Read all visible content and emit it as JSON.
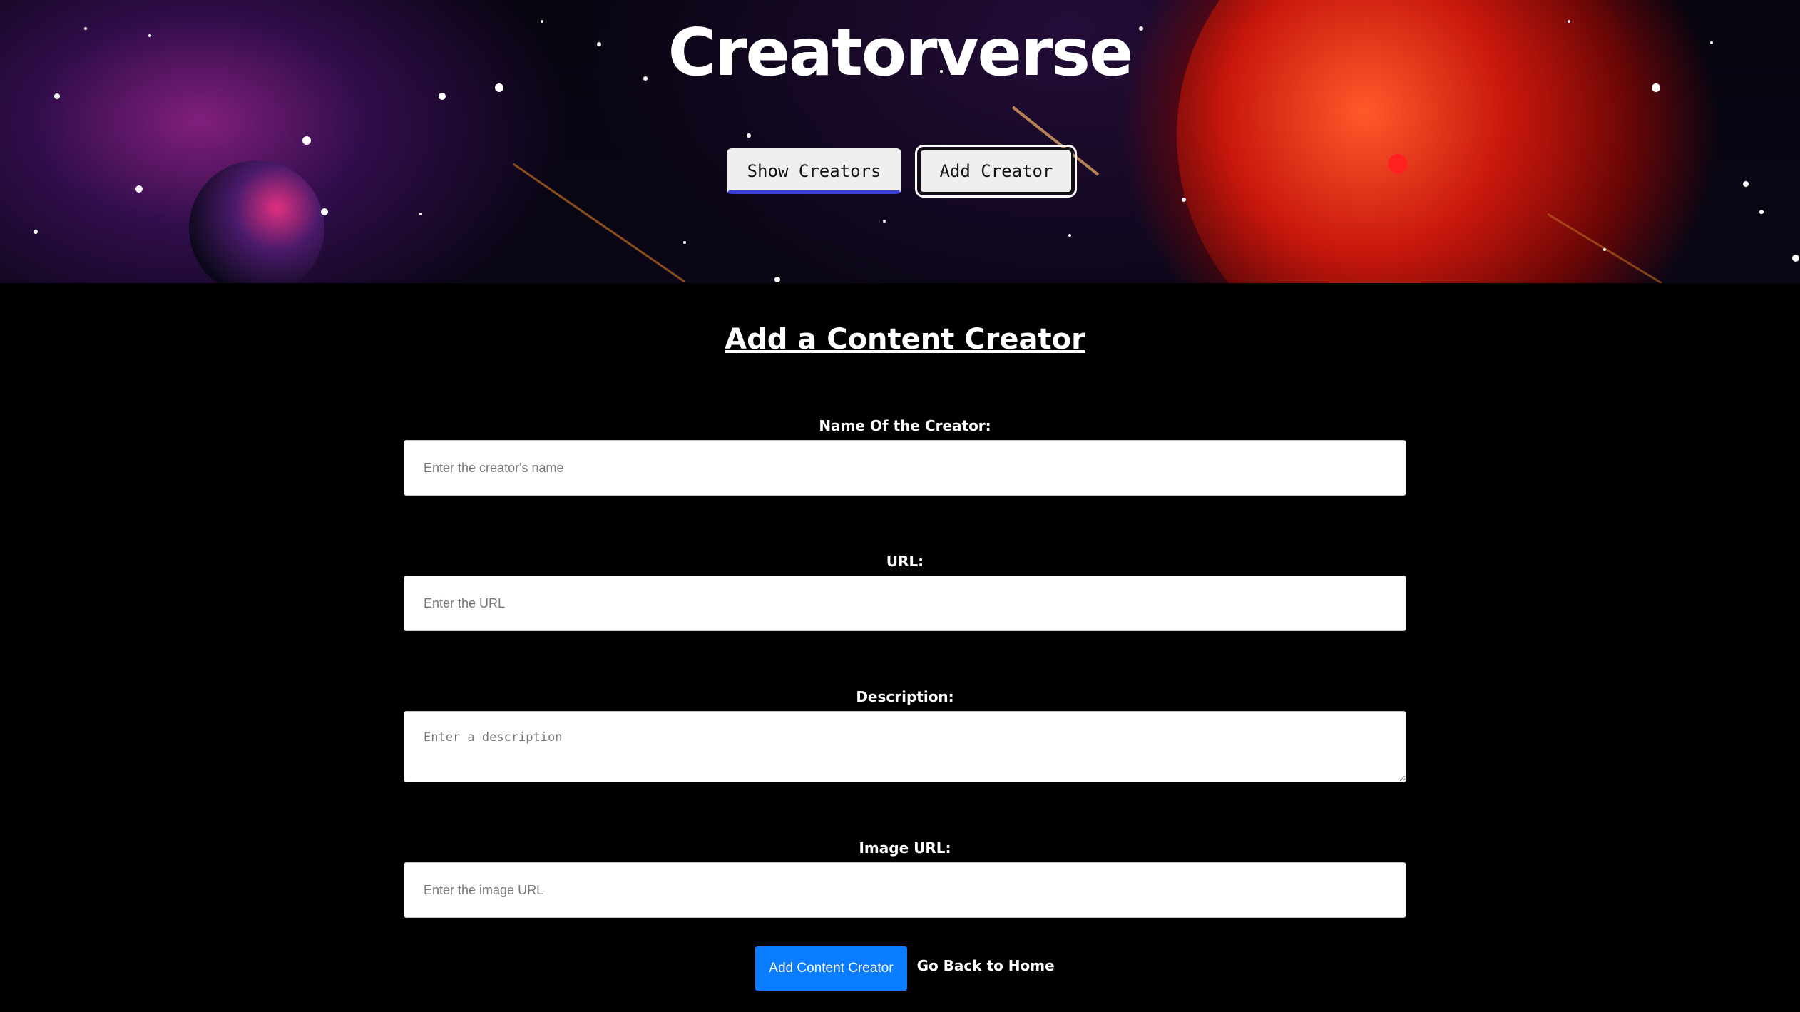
{
  "header": {
    "title": "Creatorverse",
    "nav": {
      "show_label": "Show Creators",
      "add_label": "Add Creator"
    }
  },
  "form": {
    "heading": "Add a Content Creator",
    "name": {
      "label": "Name Of the Creator:",
      "placeholder": "Enter the creator's name",
      "value": ""
    },
    "url": {
      "label": "URL:",
      "placeholder": "Enter the URL",
      "value": ""
    },
    "description": {
      "label": "Description:",
      "placeholder": "Enter a description",
      "value": ""
    },
    "image_url": {
      "label": "Image URL:",
      "placeholder": "Enter the image URL",
      "value": ""
    },
    "submit_label": "Add Content Creator",
    "home_link_label": "Go Back to Home"
  },
  "colors": {
    "background": "#000000",
    "primary_button": "#0a7cff",
    "nav_accent": "#3b3fcf"
  }
}
